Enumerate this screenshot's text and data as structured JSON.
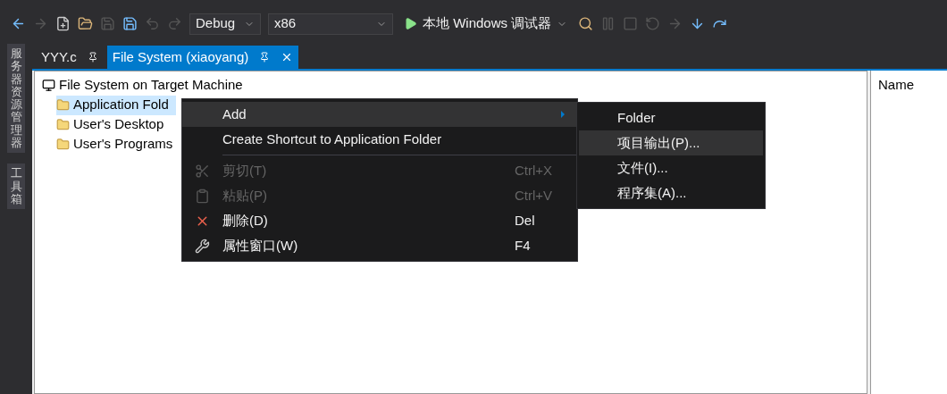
{
  "toolbar": {
    "configuration": "Debug",
    "platform": "x86",
    "debugger": "本地 Windows 调试器"
  },
  "side_tabs": [
    "服务器资源管理器",
    "工具箱"
  ],
  "tabs": [
    {
      "label": "YYY.c",
      "selected": false
    },
    {
      "label": "File System (xiaoyang)",
      "selected": true
    }
  ],
  "tree": {
    "label": "File System on Target Machine",
    "children": [
      {
        "label": "Application Fold",
        "selected": true
      },
      {
        "label": "User's Desktop",
        "selected": false
      },
      {
        "label": "User's Programs",
        "selected": false
      }
    ]
  },
  "right_panel": {
    "column": "Name"
  },
  "context_menu": [
    {
      "kind": "submenu",
      "label": "Add",
      "selected": true,
      "disabled": false
    },
    {
      "kind": "item",
      "label": "Create Shortcut to Application Folder",
      "selected": false,
      "disabled": false
    },
    {
      "kind": "separator"
    },
    {
      "kind": "item",
      "label": "剪切(T)",
      "shortcut": "Ctrl+X",
      "selected": false,
      "disabled": true
    },
    {
      "kind": "item",
      "label": "粘贴(P)",
      "shortcut": "Ctrl+V",
      "selected": false,
      "disabled": true
    },
    {
      "kind": "item",
      "label": "删除(D)",
      "shortcut": "Del",
      "selected": false,
      "disabled": false
    },
    {
      "kind": "item",
      "label": "属性窗口(W)",
      "shortcut": "F4",
      "selected": false,
      "disabled": false
    }
  ],
  "submenu": [
    {
      "label": "Folder",
      "selected": false
    },
    {
      "label": "项目输出(P)...",
      "selected": true
    },
    {
      "label": "文件(I)...",
      "selected": false
    },
    {
      "label": "程序集(A)...",
      "selected": false
    }
  ]
}
